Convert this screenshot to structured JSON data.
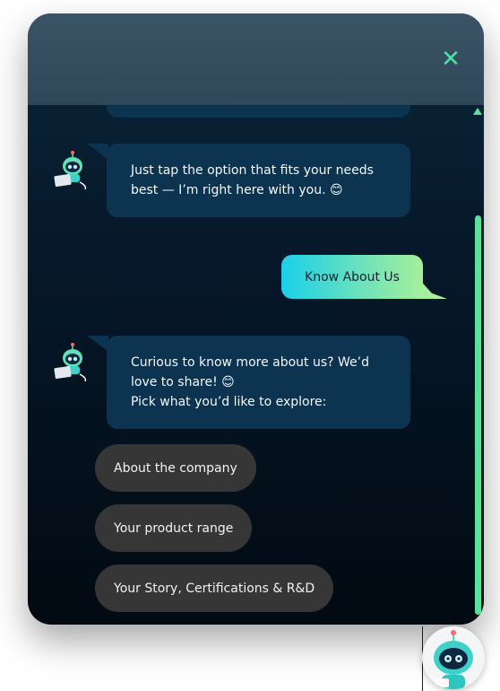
{
  "header": {
    "close_icon": "close-icon",
    "accent": "#4be3a7"
  },
  "messages": [
    {
      "type": "bot",
      "lines": [
        "Just tap the option that fits your needs",
        "best — I’m right here with you. 😊"
      ]
    },
    {
      "type": "user",
      "text": "Know About Us"
    },
    {
      "type": "bot",
      "lines": [
        "Curious to know more about us? We’d",
        "love to share! 😊",
        "Pick what you’d like to explore:"
      ]
    }
  ],
  "options": [
    {
      "label": "About the company"
    },
    {
      "label": "Your product range"
    },
    {
      "label": "Your Story, Certifications & R&D"
    }
  ],
  "colors": {
    "bot_bubble": "#0c3350",
    "user_gradient_start": "#1ad0ea",
    "user_gradient_end": "#a4ef9b",
    "option_bg": "#363636",
    "scrollbar": "#58e29a"
  },
  "icons": {
    "bot_avatar": "robot-laptop-icon",
    "launcher": "robot-launcher-icon"
  }
}
